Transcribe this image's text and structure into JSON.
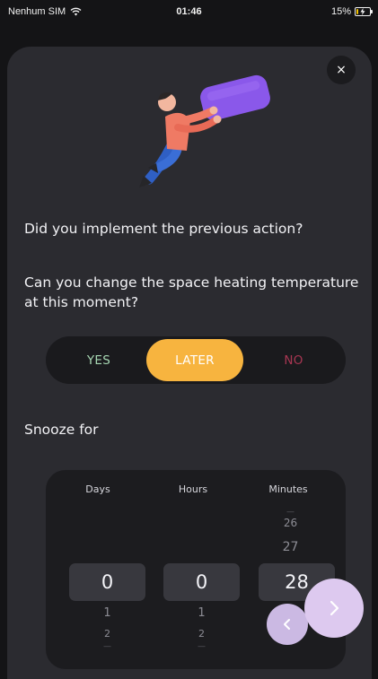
{
  "status_bar": {
    "carrier": "Nenhum SIM",
    "time": "01:46",
    "battery_text": "15%",
    "battery_level": 0.15,
    "battery_color": "#f2c200",
    "icons": [
      "wifi-icon",
      "battery-icon",
      "charging-bolt-icon"
    ]
  },
  "dialog": {
    "close_label": "×",
    "question1": "Did you implement the previous action?",
    "question2": "Can you change the space heating temperature at this moment?",
    "options": {
      "yes": "YES",
      "later": "LATER",
      "no": "NO"
    },
    "selected_option": "LATER",
    "snooze_label": "Snooze for"
  },
  "picker": {
    "days": {
      "header": "Days",
      "selected": "0",
      "below": [
        "1",
        "2"
      ]
    },
    "hours": {
      "header": "Hours",
      "selected": "0",
      "below": [
        "1",
        "2"
      ]
    },
    "minutes": {
      "header": "Minutes",
      "above": [
        "26",
        "27"
      ],
      "selected": "28"
    }
  },
  "navigation": {
    "prev_icon": "chevron-left-icon",
    "next_icon": "chevron-right-icon"
  },
  "colors": {
    "accent_later": "#f7b43f",
    "yes_text": "#a8d8b4",
    "no_text": "#a83652",
    "sheet_bg": "#2b2b30",
    "nav_button": "#ddc9ef"
  }
}
